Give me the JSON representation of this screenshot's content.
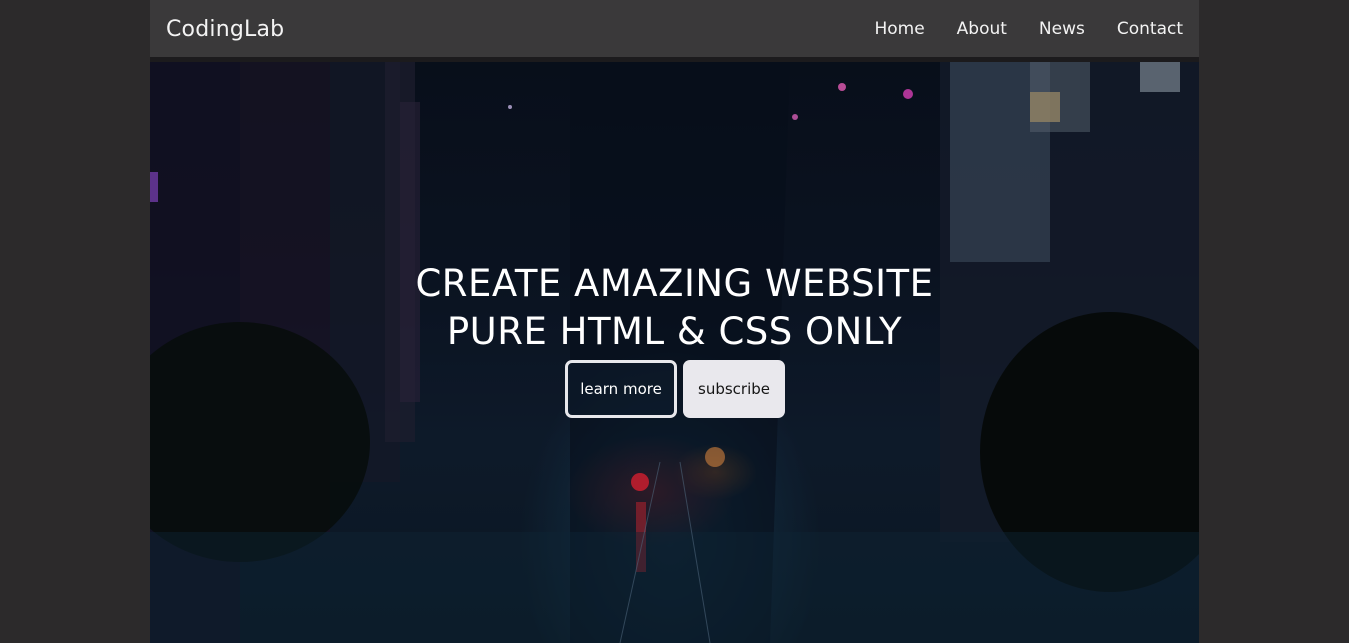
{
  "navbar": {
    "logo": "CodingLab",
    "links": [
      "Home",
      "About",
      "News",
      "Contact"
    ]
  },
  "hero": {
    "title_line1": "CREATE AMAZING WEBSITE",
    "title_line2": "PURE HTML & CSS ONLY",
    "learn_more_label": "learn more",
    "subscribe_label": "subscribe"
  },
  "colors": {
    "page_background": "#2c2a2b",
    "navbar_background": "#3a393a",
    "subscribe_button": "#e9e8ed"
  }
}
